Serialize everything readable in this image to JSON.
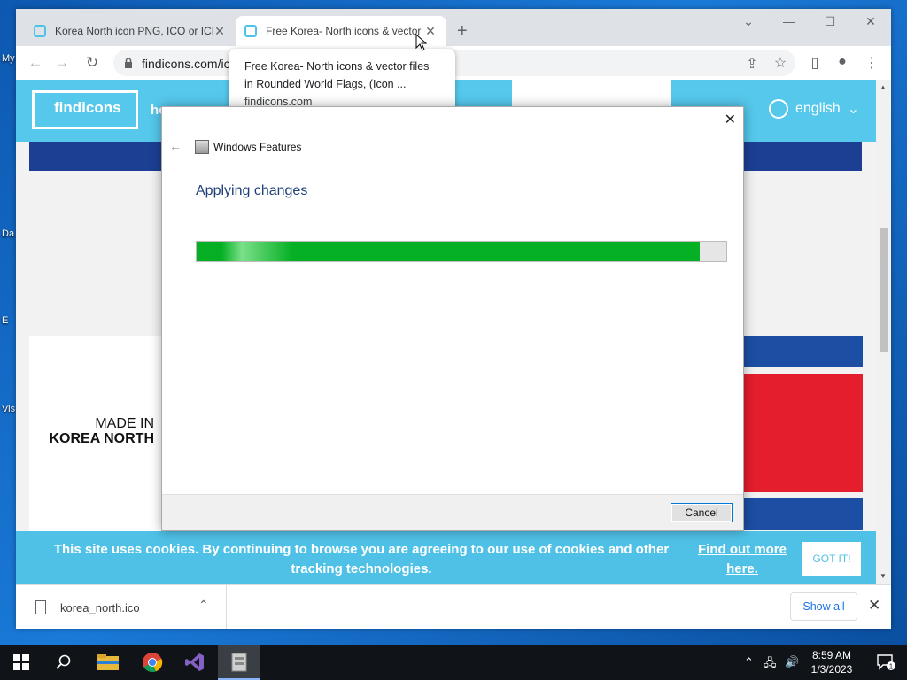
{
  "desktop": {
    "icons": [
      {
        "label": "My"
      },
      {
        "label": "Da"
      },
      {
        "label": "E"
      },
      {
        "label": "Vis"
      }
    ]
  },
  "browser": {
    "tabs": [
      {
        "title": "Korea North icon PNG, ICO or ICNS",
        "close": "✕"
      },
      {
        "title": "Free Korea- North icons & vector files",
        "close": "✕"
      }
    ],
    "new_tab": "+",
    "window_controls": {
      "chevron": "⌄",
      "minimize": "—",
      "maximize": "☐",
      "close": "✕"
    },
    "address": "findicons.com/icon",
    "tooltip": {
      "title": "Free Korea- North icons & vector files in Rounded World Flags, (Icon ...",
      "domain": "findicons.com"
    }
  },
  "site": {
    "logo": "findicons",
    "nav_link": "ho",
    "language": "english",
    "made_in_line1": "MADE IN",
    "made_in_line2": "KOREA NORTH",
    "cookie_message": "This site uses cookies. By continuing to browse you are agreeing to our use of cookies and other tracking technologies.",
    "cookie_link": "Find out more here.",
    "cookie_button": "GOT IT!"
  },
  "downloads": {
    "file": "korea_north.ico",
    "show_all": "Show all"
  },
  "dialog": {
    "title": "Windows Features",
    "heading": "Applying changes",
    "progress": 0.95,
    "cancel": "Cancel"
  },
  "taskbar": {
    "time": "8:59 AM",
    "date": "1/3/2023",
    "notification_count": "1"
  },
  "colors": {
    "progress_green": "#06b025",
    "site_accent": "#55c8ec",
    "flag_blue": "#1c4ea3",
    "flag_red": "#e41e2d"
  }
}
